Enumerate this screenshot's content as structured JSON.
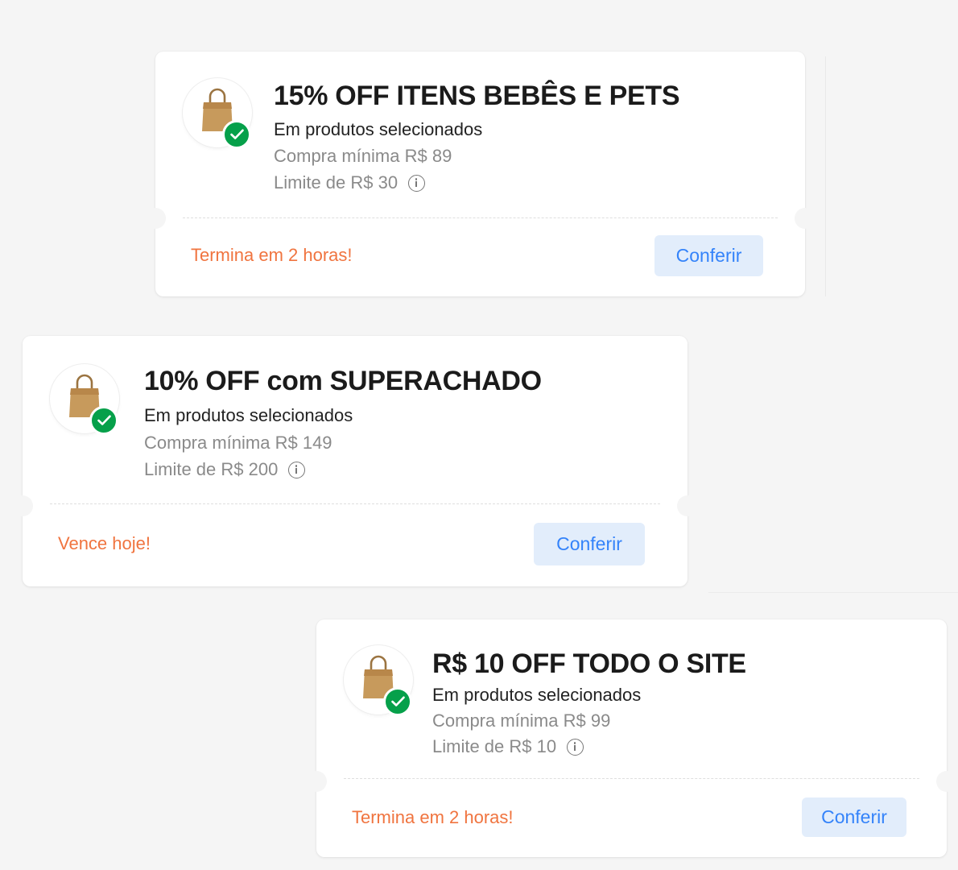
{
  "coupons": [
    {
      "title": "15% OFF ITENS BEBÊS E PETS",
      "subtitle": "Em produtos selecionados",
      "min_purchase": "Compra mínima R$ 89",
      "limit": "Limite de R$ 30",
      "expiry": "Termina em 2 horas!",
      "button_label": "Conferir"
    },
    {
      "title": "10% OFF com SUPERACHADO",
      "subtitle": "Em produtos selecionados",
      "min_purchase": "Compra mínima R$ 149",
      "limit": "Limite de R$ 200",
      "expiry": "Vence hoje!",
      "button_label": "Conferir"
    },
    {
      "title": "R$ 10 OFF TODO O SITE",
      "subtitle": "Em produtos selecionados",
      "min_purchase": "Compra mínima R$ 99",
      "limit": "Limite de R$ 10",
      "expiry": "Termina em 2 horas!",
      "button_label": "Conferir"
    }
  ],
  "icons": {
    "logo": "shopping-bag-icon",
    "badge": "check-icon",
    "info": "info-icon"
  },
  "colors": {
    "background": "#f5f5f5",
    "card": "#ffffff",
    "title": "#1b1b1b",
    "muted": "#8a8a8a",
    "expiry": "#f0743f",
    "button_bg": "#e2edfb",
    "button_text": "#3483fa",
    "check": "#06a04a",
    "bag": "#c79a5c"
  }
}
